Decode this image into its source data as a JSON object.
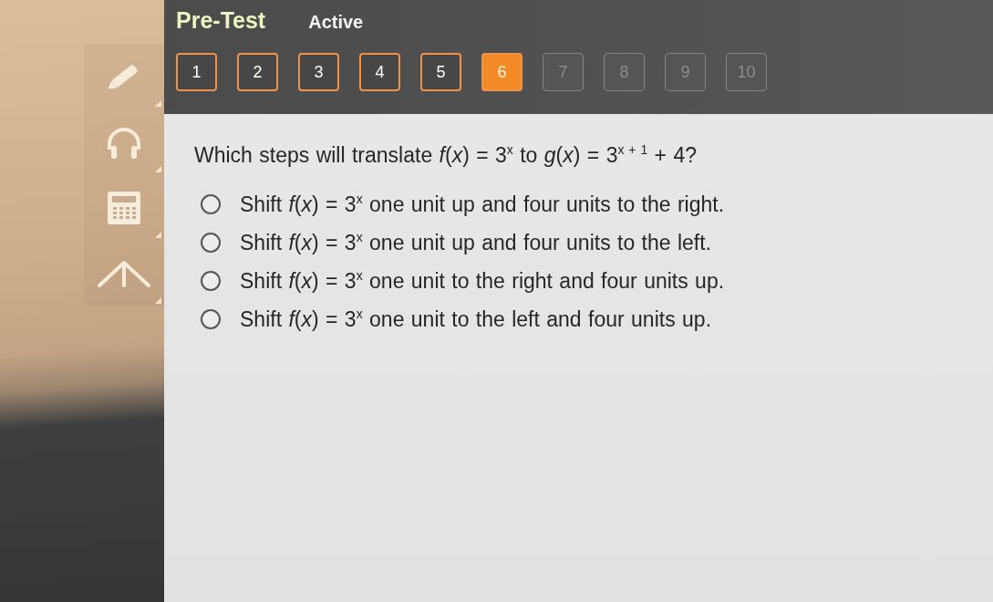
{
  "header": {
    "title": "Pre-Test",
    "status": "Active"
  },
  "question_nav": [
    {
      "label": "1",
      "selected": false,
      "visited": true
    },
    {
      "label": "2",
      "selected": false,
      "visited": true
    },
    {
      "label": "3",
      "selected": false,
      "visited": true
    },
    {
      "label": "4",
      "selected": false,
      "visited": true
    },
    {
      "label": "5",
      "selected": false,
      "visited": true
    },
    {
      "label": "6",
      "selected": true,
      "visited": true
    },
    {
      "label": "7",
      "selected": false,
      "visited": false
    },
    {
      "label": "8",
      "selected": false,
      "visited": false
    },
    {
      "label": "9",
      "selected": false,
      "visited": false
    },
    {
      "label": "10",
      "selected": false,
      "visited": false
    }
  ],
  "question": {
    "text": "Which steps will translate *f*(*x*) = 3$^{x}$ to *g*(*x*) = 3$^{x + 1}$ + 4?"
  },
  "options": [
    {
      "text": "Shift *f*(*x*) = 3$^{x}$ one unit up and four units to the right.",
      "selected": false
    },
    {
      "text": "Shift *f*(*x*) = 3$^{x}$ one unit up and four units to the left.",
      "selected": false
    },
    {
      "text": "Shift *f*(*x*) = 3$^{x}$ one unit to the right and four units up.",
      "selected": false
    },
    {
      "text": "Shift *f*(*x*) = 3$^{x}$ one unit to the left and four units up.",
      "selected": false
    }
  ]
}
